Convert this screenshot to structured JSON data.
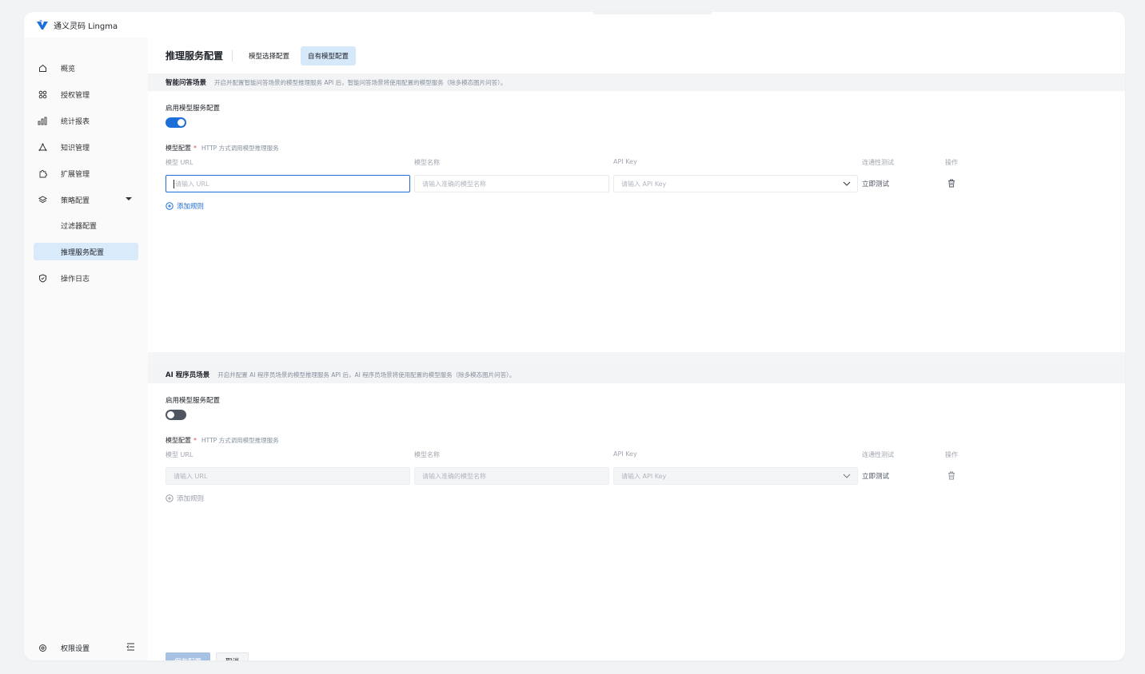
{
  "app": {
    "title": "通义灵码 Lingma",
    "brand_color": "#1c6fd9"
  },
  "sidebar": {
    "items": [
      {
        "label": "概览",
        "icon": "home-icon"
      },
      {
        "label": "授权管理",
        "icon": "grid-icon"
      },
      {
        "label": "统计报表",
        "icon": "bar-chart-icon"
      },
      {
        "label": "知识管理",
        "icon": "network-icon"
      },
      {
        "label": "扩展管理",
        "icon": "puzzle-icon"
      },
      {
        "label": "策略配置",
        "icon": "layers-icon",
        "expanded": true
      },
      {
        "label": "过滤器配置",
        "sub": true
      },
      {
        "label": "推理服务配置",
        "sub": true,
        "active": true
      },
      {
        "label": "操作日志",
        "icon": "shield-icon"
      }
    ],
    "footer": {
      "label": "权限设置",
      "icon": "settings-icon",
      "collapse_icon": "collapse-sidebar-icon"
    }
  },
  "header": {
    "title": "推理服务配置",
    "tabs": [
      {
        "label": "模型选择配置",
        "active": false
      },
      {
        "label": "自有模型配置",
        "active": true
      }
    ]
  },
  "sections": [
    {
      "name": "智能问答场景",
      "desc": "开启并配置智能问答场景的模型推理服务 API 后，智能问答场景将使用配置的模型服务（除多模态图片问答）。",
      "enable_label": "启用模型服务配置",
      "enabled": true,
      "config_label": "模型配置",
      "config_hint": "HTTP 方式调用模型推理服务",
      "columns": {
        "url": "模型 URL",
        "name": "模型名称",
        "key": "API Key",
        "test": "连通性测试",
        "ops": "操作"
      },
      "row": {
        "url_placeholder": "请输入 URL",
        "name_placeholder": "请输入准确的模型名称",
        "key_placeholder": "请输入 API Key",
        "test_label": "立即测试"
      },
      "add_rule": "添加规则"
    },
    {
      "name": "AI 程序员场景",
      "desc": "开启并配置 AI 程序员场景的模型推理服务 API 后，AI 程序员场景将使用配置的模型服务（除多模态图片问答）。",
      "enable_label": "启用模型服务配置",
      "enabled": false,
      "config_label": "模型配置",
      "config_hint": "HTTP 方式调用模型推理服务",
      "columns": {
        "url": "模型 URL",
        "name": "模型名称",
        "key": "API Key",
        "test": "连通性测试",
        "ops": "操作"
      },
      "row": {
        "url_placeholder": "请输入 URL",
        "name_placeholder": "请输入准确的模型名称",
        "key_placeholder": "请输入 API Key",
        "test_label": "立即测试"
      },
      "add_rule": "添加规则"
    }
  ],
  "footer": {
    "save_label": "保存配置",
    "cancel_label": "取消"
  }
}
